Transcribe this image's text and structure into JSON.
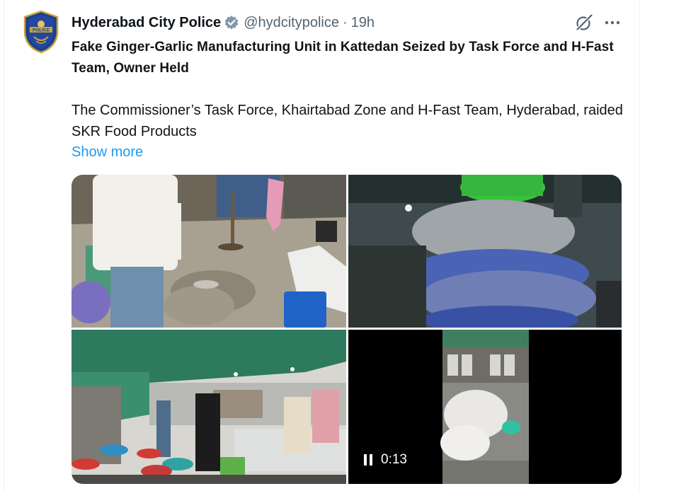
{
  "post": {
    "author_name": "Hyderabad City Police",
    "handle": "@hydcitypolice",
    "separator": "·",
    "time": "19h",
    "headline": "Fake Ginger-Garlic Manufacturing Unit in Kattedan Seized by Task Force and H-Fast Team, Owner Held",
    "body": "The Commissioner’s Task Force, Khairtabad Zone and H-Fast Team, Hyderabad, raided SKR Food Products",
    "show_more": "Show more",
    "avatar_text": "POLICE"
  },
  "media": {
    "video_time": "0:13",
    "tiles": [
      {
        "name": "photo-seized-sacks"
      },
      {
        "name": "photo-garlic-bags"
      },
      {
        "name": "photo-factory-interior"
      },
      {
        "name": "video-sacks"
      }
    ]
  },
  "icons": {
    "verified": "verified-badge-icon",
    "grok": "grok-icon",
    "more": "more-options-icon",
    "pause": "pause-icon"
  },
  "colors": {
    "link": "#1d9bf0",
    "secondary_text": "#536471",
    "verified_gray": "#829aab"
  }
}
